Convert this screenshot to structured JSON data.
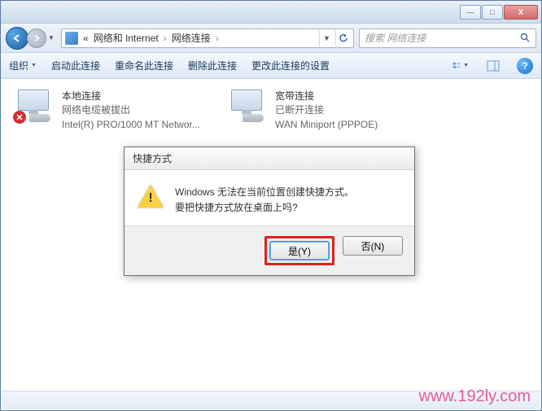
{
  "titlebar": {
    "min": "—",
    "max": "□",
    "close": "X"
  },
  "breadcrumb": {
    "sep0": "«",
    "part1": "网络和 Internet",
    "sep": "›",
    "part2": "网络连接",
    "sep2": "›"
  },
  "search": {
    "placeholder": "搜索 网络连接"
  },
  "toolbar": {
    "organize": "组织",
    "start": "启动此连接",
    "rename": "重命名此连接",
    "delete": "删除此连接",
    "change": "更改此连接的设置"
  },
  "connections": [
    {
      "name": "本地连接",
      "status": "网络电缆被拔出",
      "device": "Intel(R) PRO/1000 MT Networ..."
    },
    {
      "name": "宽带连接",
      "status": "已断开连接",
      "device": "WAN Miniport (PPPOE)"
    }
  ],
  "dialog": {
    "title": "快捷方式",
    "line1": "Windows 无法在当前位置创建快捷方式。",
    "line2": "要把快捷方式放在桌面上吗?",
    "yes": "是(Y)",
    "no": "否(N)"
  },
  "watermark": "www.192ly.com"
}
